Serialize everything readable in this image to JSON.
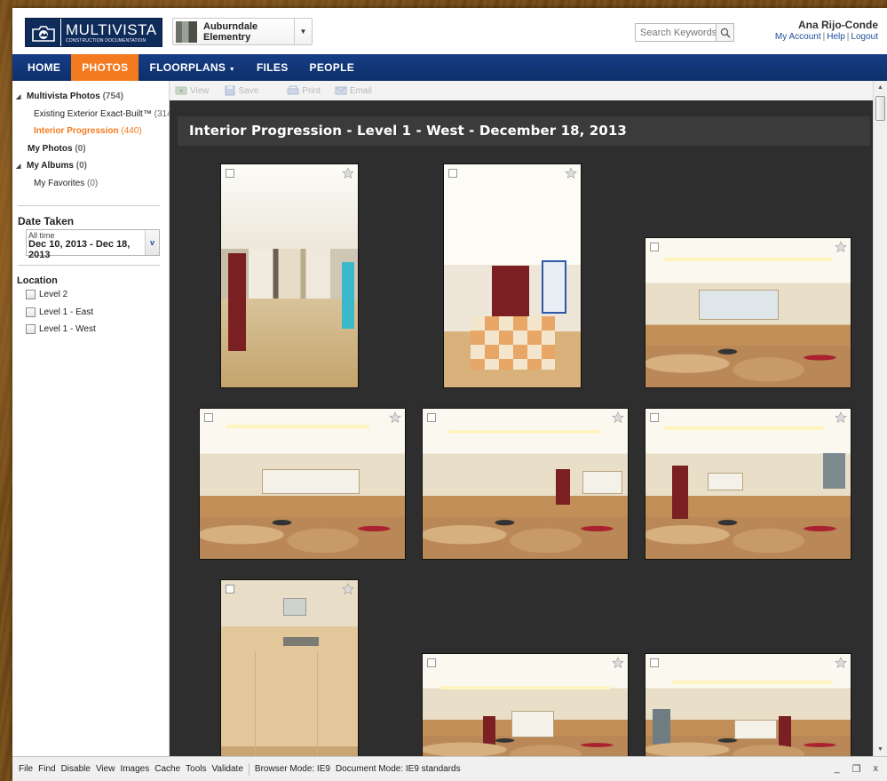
{
  "header": {
    "logo_title": "MULTIVISTA",
    "logo_subtitle": "CONSTRUCTION DOCUMENTATION",
    "project_name": "Auburndale Elementry",
    "search_placeholder": "Search Keywords",
    "user_name": "Ana Rijo-Conde",
    "links": [
      "My Account",
      "Help",
      "Logout"
    ]
  },
  "nav": [
    "HOME",
    "PHOTOS",
    "FLOORPLANS",
    "FILES",
    "PEOPLE"
  ],
  "nav_active": "PHOTOS",
  "sidebar": {
    "tree": [
      {
        "label": "Multivista Photos",
        "count": "(754)",
        "level": 0,
        "expanded": true
      },
      {
        "label": "Existing Exterior Exact-Built™",
        "count": "(314)",
        "level": 1
      },
      {
        "label": "Interior Progression",
        "count": "(440)",
        "level": 1,
        "selected": true
      },
      {
        "label": "My Photos",
        "count": "(0)",
        "level": 0
      },
      {
        "label": "My Albums",
        "count": "(0)",
        "level": 0,
        "expanded": true
      },
      {
        "label": "My Favorites",
        "count": "(0)",
        "level": 1
      }
    ],
    "date_taken": {
      "title": "Date Taken",
      "mode": "All time",
      "range": "Dec 10, 2013 - Dec 18, 2013"
    },
    "location": {
      "title": "Location",
      "items": [
        "Level 2",
        "Level 1 - East",
        "Level 1 - West"
      ]
    }
  },
  "toolbar": [
    "View",
    "Save",
    "Print",
    "Email"
  ],
  "gallery": {
    "title": "Interior Progression - Level 1 - West - December 18, 2013",
    "photos": [
      {
        "subject": "corridor",
        "orientation": "portrait"
      },
      {
        "subject": "hallway double doors",
        "orientation": "portrait"
      },
      {
        "subject": "classroom",
        "orientation": "landscape"
      },
      {
        "subject": "classroom",
        "orientation": "landscape"
      },
      {
        "subject": "classroom",
        "orientation": "landscape"
      },
      {
        "subject": "classroom",
        "orientation": "landscape"
      },
      {
        "subject": "restroom",
        "orientation": "portrait"
      },
      {
        "subject": "classroom",
        "orientation": "landscape"
      },
      {
        "subject": "classroom",
        "orientation": "landscape"
      }
    ]
  },
  "devbar": {
    "menus": [
      "File",
      "Find",
      "Disable",
      "View",
      "Images",
      "Cache",
      "Tools",
      "Validate"
    ],
    "browser_mode": "Browser Mode: IE9",
    "document_mode": "Document Mode: IE9 standards"
  },
  "colors": {
    "nav_blue": "#123878",
    "accent_orange": "#f47a20",
    "gallery_bg": "#2e2e2e"
  }
}
